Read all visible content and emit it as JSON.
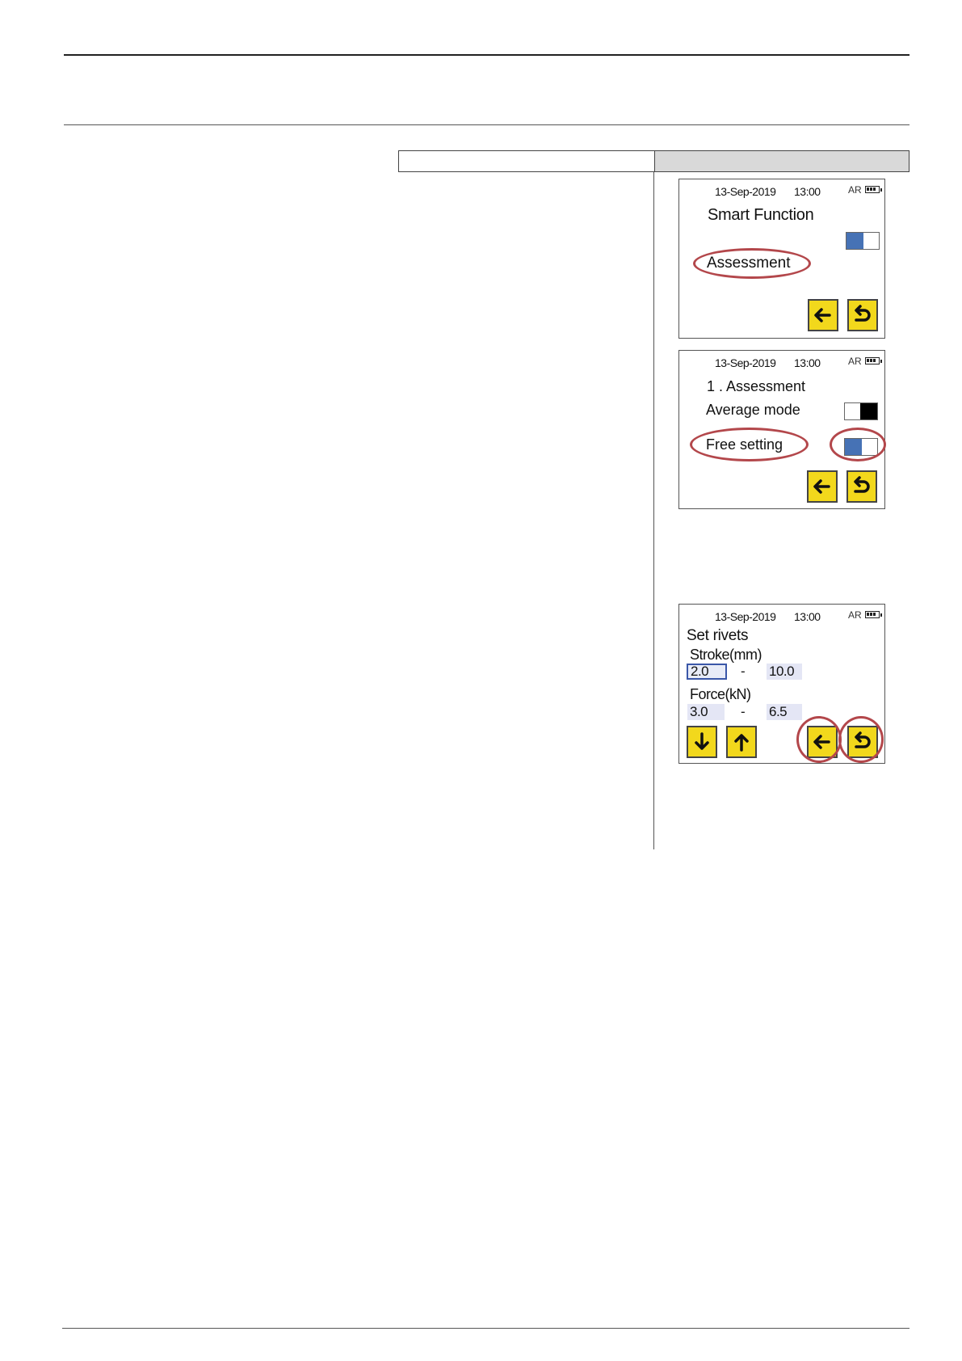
{
  "screens": [
    {
      "status": {
        "date": "13-Sep-2019",
        "time": "13:00",
        "mode": "AR"
      },
      "title": "Smart Function",
      "item": "Assessment"
    },
    {
      "status": {
        "date": "13-Sep-2019",
        "time": "13:00",
        "mode": "AR"
      },
      "title": "1 . Assessment",
      "average_mode": "Average mode",
      "free_setting": "Free setting"
    },
    {
      "status": {
        "date": "13-Sep-2019",
        "time": "13:00",
        "mode": "AR"
      },
      "title": "Set rivets",
      "stroke_label": "Stroke(mm)",
      "stroke_min": "2.0",
      "stroke_sep": "-",
      "stroke_max": "10.0",
      "force_label": "Force(kN)",
      "force_min": "3.0",
      "force_sep": "-",
      "force_max": "6.5"
    }
  ],
  "icons": {
    "back": "arrow-left-icon",
    "return": "return-icon",
    "down": "arrow-down-icon",
    "up": "arrow-up-icon"
  },
  "colors": {
    "button_yellow": "#f2d81c",
    "toggle_blue": "#4672b5",
    "highlight_oval": "#b3474b",
    "header_gray": "#d9d9d9"
  }
}
